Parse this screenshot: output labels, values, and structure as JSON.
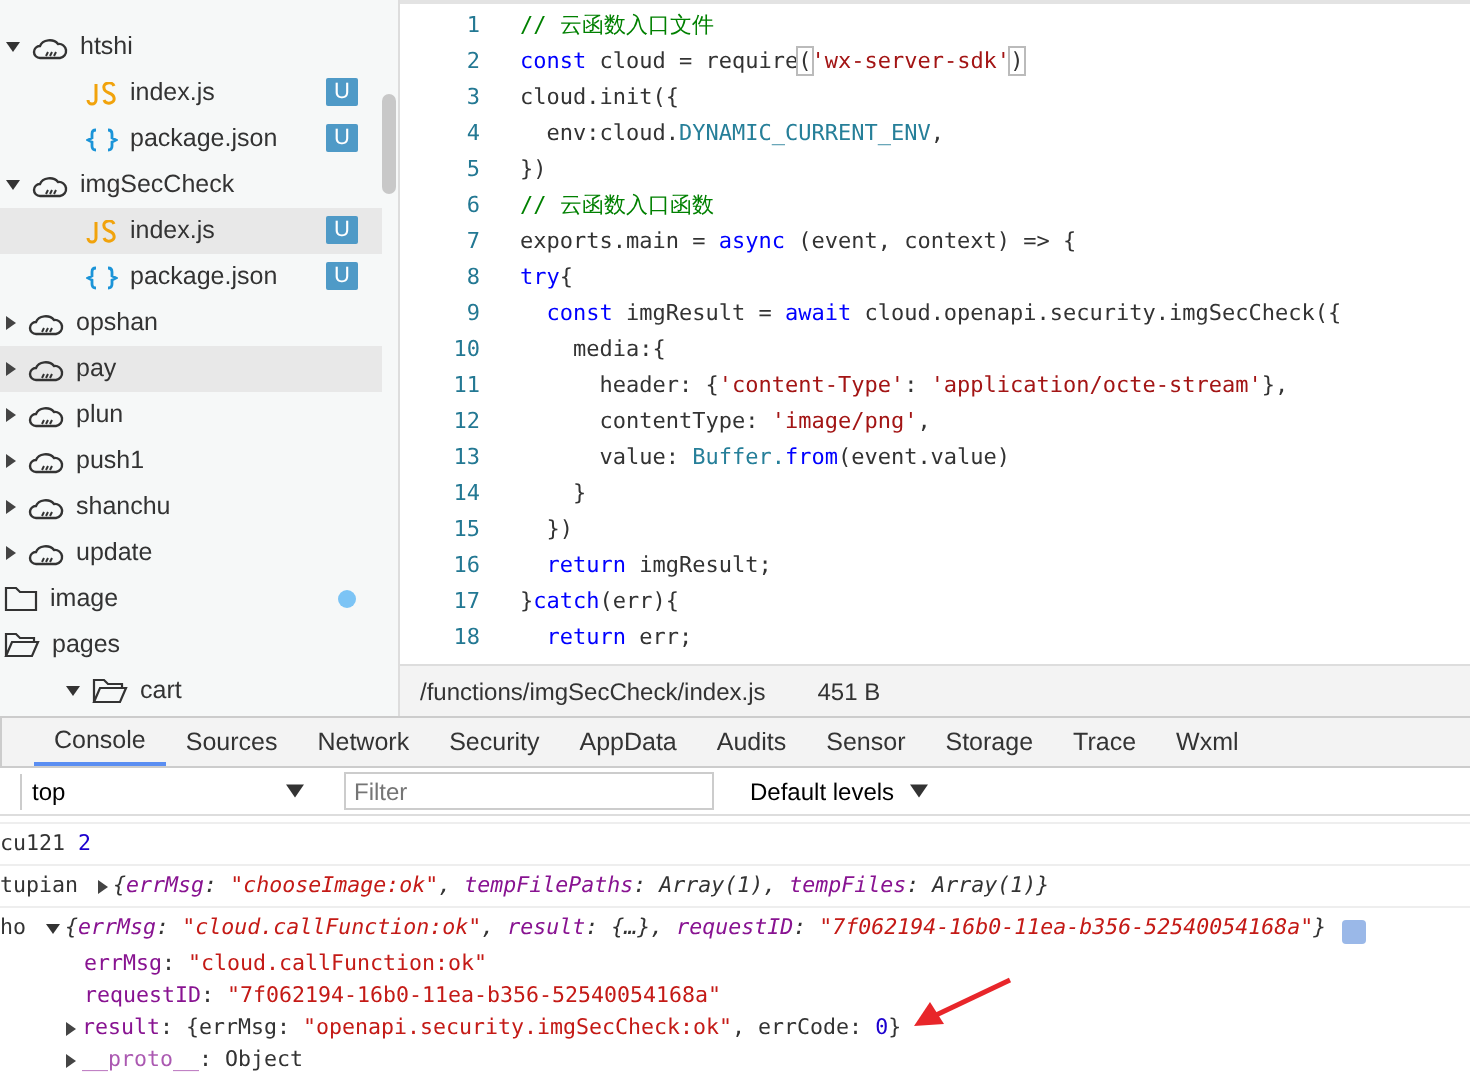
{
  "sidebar": {
    "items": [
      {
        "label": "htshi",
        "kind": "cloud-folder",
        "expanded": true,
        "selected": false,
        "children": [
          {
            "label": "index.js",
            "kind": "js",
            "badge": "U",
            "selected": false
          },
          {
            "label": "package.json",
            "kind": "json",
            "badge": "U",
            "selected": false
          }
        ]
      },
      {
        "label": "imgSecCheck",
        "kind": "cloud-folder",
        "expanded": true,
        "selected": false,
        "children": [
          {
            "label": "index.js",
            "kind": "js",
            "badge": "U",
            "selected": true
          },
          {
            "label": "package.json",
            "kind": "json",
            "badge": "U",
            "selected": false
          }
        ]
      },
      {
        "label": "opshan",
        "kind": "cloud-folder",
        "expanded": false,
        "selected": false
      },
      {
        "label": "pay",
        "kind": "cloud-folder",
        "expanded": false,
        "selected": true
      },
      {
        "label": "plun",
        "kind": "cloud-folder",
        "expanded": false,
        "selected": false
      },
      {
        "label": "push1",
        "kind": "cloud-folder",
        "expanded": false,
        "selected": false
      },
      {
        "label": "shanchu",
        "kind": "cloud-folder",
        "expanded": false,
        "selected": false
      },
      {
        "label": "update",
        "kind": "cloud-folder",
        "expanded": false,
        "selected": false
      },
      {
        "label": "image",
        "kind": "folder",
        "expanded": false,
        "selected": false,
        "modified": true,
        "top_level": true
      },
      {
        "label": "pages",
        "kind": "folder",
        "expanded": true,
        "selected": false,
        "top_level": true,
        "children": [
          {
            "label": "cart",
            "kind": "folder",
            "expanded": true,
            "selected": false
          }
        ]
      }
    ]
  },
  "editor": {
    "lines": [
      {
        "number": "1",
        "tokens": [
          {
            "kind": "comment",
            "text": "// 云函数入口文件"
          }
        ]
      },
      {
        "number": "2",
        "tokens": [
          {
            "kind": "keyword",
            "text": "const"
          },
          {
            "kind": "plain",
            "text": " cloud = require"
          },
          {
            "kind": "bracket",
            "text": "("
          },
          {
            "kind": "string",
            "text": "'wx-server-sdk'"
          },
          {
            "kind": "bracket",
            "text": ")"
          }
        ]
      },
      {
        "number": "3",
        "tokens": [
          {
            "kind": "plain",
            "text": "cloud.init({"
          }
        ]
      },
      {
        "number": "4",
        "tokens": [
          {
            "kind": "plain",
            "text": "  env:cloud."
          },
          {
            "kind": "type",
            "text": "DYNAMIC_CURRENT_ENV"
          },
          {
            "kind": "plain",
            "text": ","
          }
        ]
      },
      {
        "number": "5",
        "tokens": [
          {
            "kind": "plain",
            "text": "})"
          }
        ]
      },
      {
        "number": "6",
        "tokens": [
          {
            "kind": "comment",
            "text": "// 云函数入口函数"
          }
        ]
      },
      {
        "number": "7",
        "tokens": [
          {
            "kind": "plain",
            "text": "exports.main = "
          },
          {
            "kind": "keyword",
            "text": "async"
          },
          {
            "kind": "plain",
            "text": " (event, context) => {"
          }
        ]
      },
      {
        "number": "8",
        "tokens": [
          {
            "kind": "keyword",
            "text": "try"
          },
          {
            "kind": "plain",
            "text": "{"
          }
        ]
      },
      {
        "number": "9",
        "tokens": [
          {
            "kind": "keyword",
            "text": "  const"
          },
          {
            "kind": "plain",
            "text": " imgResult = "
          },
          {
            "kind": "keyword",
            "text": "await"
          },
          {
            "kind": "plain",
            "text": " cloud.openapi.security.imgSecCheck({"
          }
        ]
      },
      {
        "number": "10",
        "tokens": [
          {
            "kind": "plain",
            "text": "    media:{"
          }
        ]
      },
      {
        "number": "11",
        "tokens": [
          {
            "kind": "plain",
            "text": "      header: {"
          },
          {
            "kind": "string",
            "text": "'content-Type'"
          },
          {
            "kind": "plain",
            "text": ": "
          },
          {
            "kind": "string",
            "text": "'application/octe-stream'"
          },
          {
            "kind": "plain",
            "text": "},"
          }
        ]
      },
      {
        "number": "12",
        "tokens": [
          {
            "kind": "plain",
            "text": "      contentType: "
          },
          {
            "kind": "string",
            "text": "'image/png'"
          },
          {
            "kind": "plain",
            "text": ","
          }
        ]
      },
      {
        "number": "13",
        "tokens": [
          {
            "kind": "plain",
            "text": "      value: "
          },
          {
            "kind": "type",
            "text": "Buffer."
          },
          {
            "kind": "keyword",
            "text": "from"
          },
          {
            "kind": "plain",
            "text": "(event.value)"
          }
        ]
      },
      {
        "number": "14",
        "tokens": [
          {
            "kind": "plain",
            "text": "    }"
          }
        ]
      },
      {
        "number": "15",
        "tokens": [
          {
            "kind": "plain",
            "text": "  })"
          }
        ]
      },
      {
        "number": "16",
        "tokens": [
          {
            "kind": "keyword",
            "text": "  return"
          },
          {
            "kind": "plain",
            "text": " imgResult;"
          }
        ]
      },
      {
        "number": "17",
        "tokens": [
          {
            "kind": "plain",
            "text": "}"
          },
          {
            "kind": "keyword",
            "text": "catch"
          },
          {
            "kind": "plain",
            "text": "(err){"
          }
        ]
      },
      {
        "number": "18",
        "tokens": [
          {
            "kind": "keyword",
            "text": "  return"
          },
          {
            "kind": "plain",
            "text": " err;"
          }
        ]
      }
    ],
    "status": {
      "path": "/functions/imgSecCheck/index.js",
      "size": "451 B"
    }
  },
  "devtools": {
    "tabs": [
      {
        "label": "Console",
        "selected": true
      },
      {
        "label": "Sources",
        "selected": false
      },
      {
        "label": "Network",
        "selected": false
      },
      {
        "label": "Security",
        "selected": false
      },
      {
        "label": "AppData",
        "selected": false
      },
      {
        "label": "Audits",
        "selected": false
      },
      {
        "label": "Sensor",
        "selected": false
      },
      {
        "label": "Storage",
        "selected": false
      },
      {
        "label": "Trace",
        "selected": false
      },
      {
        "label": "Wxml",
        "selected": false
      }
    ],
    "context": "top",
    "filter_placeholder": "Filter",
    "levels": "Default levels",
    "console": [
      {
        "source": "cu121",
        "tokens": [
          {
            "kind": "number",
            "text": "2"
          }
        ]
      },
      {
        "source": "tupian",
        "expanded": false,
        "preview": true,
        "tokens": [
          {
            "kind": "plain",
            "text": "{"
          },
          {
            "kind": "key",
            "text": "errMsg"
          },
          {
            "kind": "plain",
            "text": ": "
          },
          {
            "kind": "string",
            "text": "\"chooseImage:ok\""
          },
          {
            "kind": "plain",
            "text": ", "
          },
          {
            "kind": "key",
            "text": "tempFilePaths"
          },
          {
            "kind": "plain",
            "text": ": Array(1), "
          },
          {
            "kind": "key",
            "text": "tempFiles"
          },
          {
            "kind": "plain",
            "text": ": Array(1)}"
          }
        ]
      },
      {
        "source": "ho",
        "expanded": true,
        "preview": true,
        "info": true,
        "tokens": [
          {
            "kind": "plain",
            "text": "{"
          },
          {
            "kind": "key",
            "text": "errMsg"
          },
          {
            "kind": "plain",
            "text": ": "
          },
          {
            "kind": "string",
            "text": "\"cloud.callFunction:ok\""
          },
          {
            "kind": "plain",
            "text": ", "
          },
          {
            "kind": "key",
            "text": "result"
          },
          {
            "kind": "plain",
            "text": ": {…}, "
          },
          {
            "kind": "key",
            "text": "requestID"
          },
          {
            "kind": "plain",
            "text": ": "
          },
          {
            "kind": "string",
            "text": "\"7f062194-16b0-11ea-b356-52540054168a\""
          },
          {
            "kind": "plain",
            "text": "}"
          }
        ],
        "children": [
          {
            "tokens": [
              {
                "kind": "key",
                "text": "errMsg"
              },
              {
                "kind": "plain",
                "text": ": "
              },
              {
                "kind": "string",
                "text": "\"cloud.callFunction:ok\""
              }
            ]
          },
          {
            "tokens": [
              {
                "kind": "key",
                "text": "requestID"
              },
              {
                "kind": "plain",
                "text": ": "
              },
              {
                "kind": "string",
                "text": "\"7f062194-16b0-11ea-b356-52540054168a\""
              }
            ]
          },
          {
            "expanded": false,
            "tokens": [
              {
                "kind": "key",
                "text": "result"
              },
              {
                "kind": "plain",
                "text": ": {errMsg: "
              },
              {
                "kind": "string",
                "text": "\"openapi.security.imgSecCheck:ok\""
              },
              {
                "kind": "plain",
                "text": ", errCode: "
              },
              {
                "kind": "number",
                "text": "0"
              },
              {
                "kind": "plain",
                "text": "}"
              }
            ]
          },
          {
            "expanded": false,
            "tokens": [
              {
                "kind": "proto",
                "text": "__proto__"
              },
              {
                "kind": "plain",
                "text": ": Object"
              }
            ]
          }
        ]
      }
    ]
  }
}
